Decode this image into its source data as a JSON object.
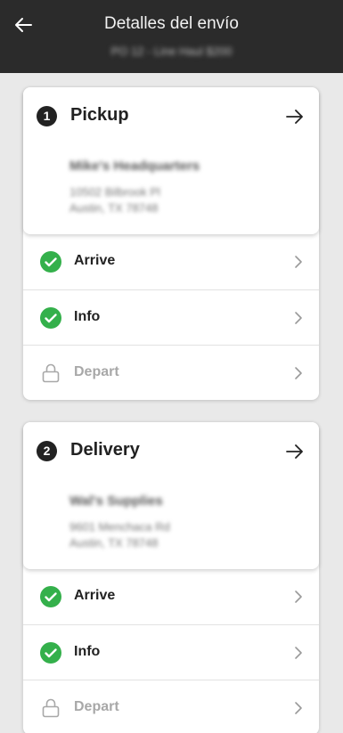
{
  "header": {
    "title": "Detalles del envío",
    "subtitle": "PO 12 - Line Haul $200"
  },
  "stops": [
    {
      "number": "1",
      "title": "Pickup",
      "company": "Mike's Headquarters",
      "address_line1": "10502 Bilbrook Pl",
      "address_line2": "Austin, TX 78748",
      "rows": [
        {
          "label": "Arrive",
          "icon": "check-circle-icon",
          "state": "done"
        },
        {
          "label": "Info",
          "icon": "check-circle-icon",
          "state": "done"
        },
        {
          "label": "Depart",
          "icon": "lock-icon",
          "state": "locked"
        }
      ]
    },
    {
      "number": "2",
      "title": "Delivery",
      "company": "Wal's Supplies",
      "address_line1": "9601 Menchaca Rd",
      "address_line2": "Austin, TX 78748",
      "rows": [
        {
          "label": "Arrive",
          "icon": "check-circle-icon",
          "state": "done"
        },
        {
          "label": "Info",
          "icon": "check-circle-icon",
          "state": "done"
        },
        {
          "label": "Depart",
          "icon": "lock-icon",
          "state": "locked"
        }
      ]
    }
  ],
  "colors": {
    "header_bg": "#2b2b2b",
    "check_green": "#34b04b",
    "locked_gray": "#a8a8a8"
  }
}
